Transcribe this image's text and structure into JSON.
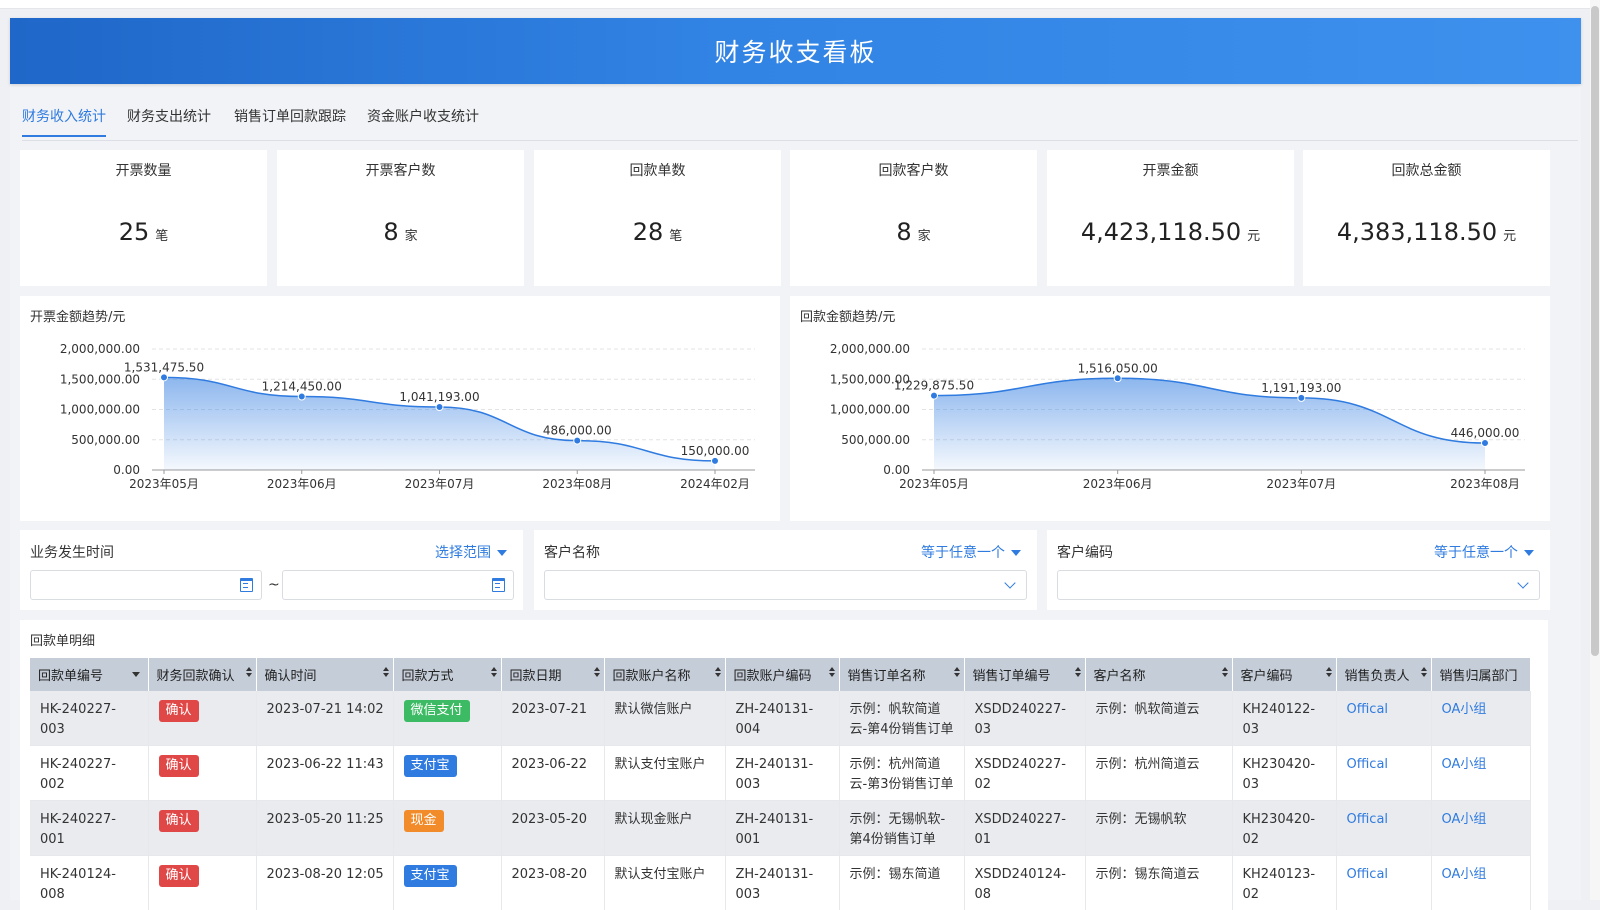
{
  "header": {
    "title": "财务收支看板"
  },
  "tabs": [
    "财务收入统计",
    "财务支出统计",
    "销售订单回款跟踪",
    "资金账户收支统计"
  ],
  "kpis": [
    {
      "label": "开票数量",
      "value": "25",
      "unit": "笔"
    },
    {
      "label": "开票客户数",
      "value": "8",
      "unit": "家"
    },
    {
      "label": "回款单数",
      "value": "28",
      "unit": "笔"
    },
    {
      "label": "回款客户数",
      "value": "8",
      "unit": "家"
    },
    {
      "label": "开票金额",
      "value": "4,423,118.50",
      "unit": "元"
    },
    {
      "label": "回款总金额",
      "value": "4,383,118.50",
      "unit": "元"
    }
  ],
  "chart_data": [
    {
      "type": "area",
      "title": "开票金额趋势/元",
      "categories": [
        "2023年05月",
        "2023年06月",
        "2023年07月",
        "2023年08月",
        "2024年02月"
      ],
      "values": [
        1531475.5,
        1214450.0,
        1041193.0,
        486000.0,
        150000.0
      ],
      "data_labels": [
        "1,531,475.50",
        "1,214,450.00",
        "1,041,193.00",
        "486,000.00",
        "150,000.00"
      ],
      "y_ticks": [
        "0.00",
        "500,000.00",
        "1,000,000.00",
        "1,500,000.00",
        "2,000,000.00"
      ],
      "ylim": [
        0,
        2000000
      ],
      "grid": true,
      "color": "#2f7be0"
    },
    {
      "type": "area",
      "title": "回款金额趋势/元",
      "categories": [
        "2023年05月",
        "2023年06月",
        "2023年07月",
        "2023年08月"
      ],
      "values": [
        1229875.5,
        1516050.0,
        1191193.0,
        446000.0
      ],
      "data_labels": [
        "1,229,875.50",
        "1,516,050.00",
        "1,191,193.00",
        "446,000.00"
      ],
      "y_ticks": [
        "0.00",
        "500,000.00",
        "1,000,000.00",
        "1,500,000.00",
        "2,000,000.00"
      ],
      "ylim": [
        0,
        2000000
      ],
      "grid": true,
      "color": "#2f7be0"
    }
  ],
  "filters": {
    "time": {
      "label": "业务发生时间",
      "op": "选择范围",
      "separator": "~"
    },
    "customer_name": {
      "label": "客户名称",
      "op": "等于任意一个"
    },
    "customer_code": {
      "label": "客户编码",
      "op": "等于任意一个"
    }
  },
  "table": {
    "title": "回款单明细",
    "columns": [
      "回款单编号",
      "财务回款确认",
      "确认时间",
      "回款方式",
      "回款日期",
      "回款账户名称",
      "回款账户编码",
      "销售订单名称",
      "销售订单编号",
      "客户名称",
      "客户编码",
      "销售负责人",
      "销售归属部门"
    ],
    "rows": [
      {
        "id": "HK-240227-003",
        "confirm": "确认",
        "confirm_time": "2023-07-21 14:02",
        "method": "微信支付",
        "method_color": "green",
        "date": "2023-07-21",
        "account_name": "默认微信账户",
        "account_code": "ZH-240131-004",
        "order_name_1": "示例：帆软简道",
        "order_name_2": "云-第4份销售订单",
        "order_no": "XSDD240227-03",
        "customer": "示例：帆软简道云",
        "customer_code": "KH240122-03",
        "owner": "Offical",
        "dept": "OA小组"
      },
      {
        "id": "HK-240227-002",
        "confirm": "确认",
        "confirm_time": "2023-06-22 11:43",
        "method": "支付宝",
        "method_color": "blue",
        "date": "2023-06-22",
        "account_name": "默认支付宝账户",
        "account_code": "ZH-240131-003",
        "order_name_1": "示例：杭州简道",
        "order_name_2": "云-第3份销售订单",
        "order_no": "XSDD240227-02",
        "customer": "示例：杭州简道云",
        "customer_code": "KH230420-03",
        "owner": "Offical",
        "dept": "OA小组"
      },
      {
        "id": "HK-240227-001",
        "confirm": "确认",
        "confirm_time": "2023-05-20 11:25",
        "method": "现金",
        "method_color": "orange",
        "date": "2023-05-20",
        "account_name": "默认现金账户",
        "account_code": "ZH-240131-001",
        "order_name_1": "示例：无锡帆软-",
        "order_name_2": "第4份销售订单",
        "order_no": "XSDD240227-01",
        "customer": "示例：无锡帆软",
        "customer_code": "KH230420-02",
        "owner": "Offical",
        "dept": "OA小组"
      },
      {
        "id": "HK-240124-008",
        "confirm": "确认",
        "confirm_time": "2023-08-20 12:05",
        "method": "支付宝",
        "method_color": "blue",
        "date": "2023-08-20",
        "account_name": "默认支付宝账户",
        "account_code": "ZH-240131-003",
        "order_name_1": "示例：锡东简道",
        "order_name_2": "",
        "order_no": "XSDD240124-08",
        "customer": "示例：锡东简道云",
        "customer_code": "KH240123-02",
        "owner": "Offical",
        "dept": "OA小组"
      }
    ]
  }
}
